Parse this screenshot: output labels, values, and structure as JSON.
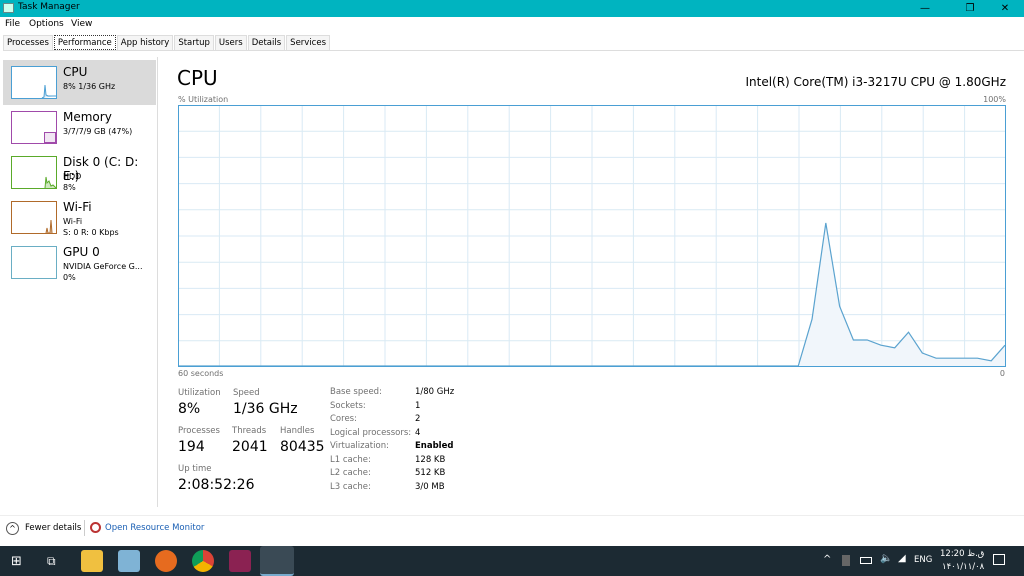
{
  "window": {
    "title": "Task Manager",
    "minimize": "—",
    "maximize": "❐",
    "close": "✕"
  },
  "menu": [
    "File",
    "Options",
    "View"
  ],
  "tabs": [
    "Processes",
    "Performance",
    "App history",
    "Startup",
    "Users",
    "Details",
    "Services"
  ],
  "active_tab": "Performance",
  "sidebar": [
    {
      "name": "CPU",
      "sub1": "8%  1/36 GHz",
      "color": "#4a9fd4"
    },
    {
      "name": "Memory",
      "sub1": "3/7/7/9 GB (47%)",
      "color": "#a04aaa"
    },
    {
      "name": "Disk 0 (C: D: E:)",
      "sub1": "HDD",
      "sub2": "8%",
      "color": "#5aaa2a"
    },
    {
      "name": "Wi-Fi",
      "sub1": "Wi-Fi",
      "sub2": "S: 0 R: 0 Kbps",
      "color": "#b06a2a"
    },
    {
      "name": "GPU 0",
      "sub1": "NVIDIA GeForce G...",
      "sub2": "0%",
      "color": "#4a9fd4"
    }
  ],
  "main": {
    "title": "CPU",
    "cpu_name": "Intel(R) Core(TM) i3-3217U CPU @ 1.80GHz",
    "util_label": "% Utilization",
    "max_label": "100%",
    "time_label": "60 seconds",
    "min_label": "0"
  },
  "chart_data": {
    "type": "area",
    "ylim": [
      0,
      100
    ],
    "xlim": [
      60,
      0
    ],
    "grid": true,
    "color": "#1e8bc3",
    "values": [
      0,
      0,
      0,
      0,
      0,
      0,
      0,
      0,
      0,
      0,
      0,
      0,
      0,
      0,
      0,
      0,
      0,
      0,
      0,
      0,
      0,
      0,
      0,
      0,
      0,
      0,
      0,
      0,
      0,
      0,
      0,
      0,
      0,
      0,
      0,
      0,
      0,
      0,
      0,
      0,
      0,
      0,
      0,
      0,
      0,
      0,
      18,
      55,
      23,
      10,
      10,
      8,
      7,
      13,
      5,
      3,
      3,
      3,
      3,
      2,
      8
    ]
  },
  "stats": {
    "utilization_label": "Utilization",
    "utilization": "8%",
    "speed_label": "Speed",
    "speed": "1/36 GHz",
    "processes_label": "Processes",
    "processes": "194",
    "threads_label": "Threads",
    "threads": "2041",
    "handles_label": "Handles",
    "handles": "80435",
    "uptime_label": "Up time",
    "uptime": "2:08:52:26"
  },
  "info": [
    [
      "Base speed:",
      "1/80 GHz"
    ],
    [
      "Sockets:",
      "1"
    ],
    [
      "Cores:",
      "2"
    ],
    [
      "Logical processors:",
      "4"
    ],
    [
      "Virtualization:",
      "Enabled"
    ],
    [
      "L1 cache:",
      "128 KB"
    ],
    [
      "L2 cache:",
      "512 KB"
    ],
    [
      "L3 cache:",
      "3/0 MB"
    ]
  ],
  "footer": {
    "fewer": "Fewer details",
    "resmon": "Open Resource Monitor"
  },
  "taskbar": {
    "lang": "ENG",
    "time": "12:20 ق.ظ",
    "date": "۱۴۰۱/۱۱/۰۸"
  }
}
